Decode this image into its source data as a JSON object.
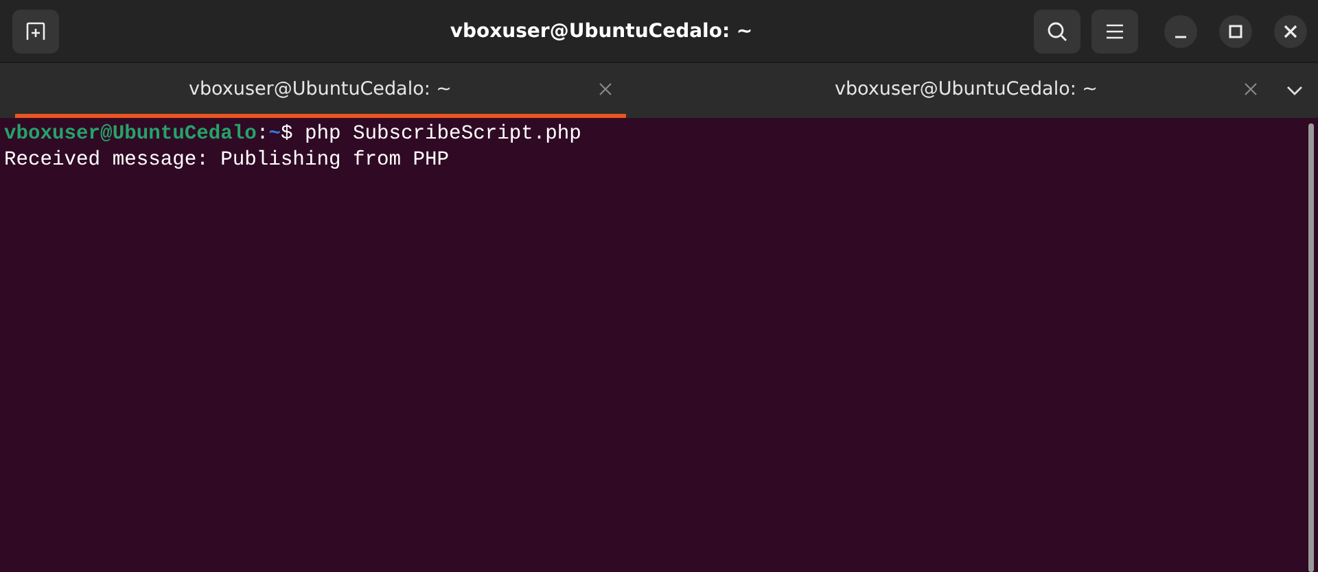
{
  "window": {
    "title": "vboxuser@UbuntuCedalo: ~"
  },
  "tabs": [
    {
      "label": "vboxuser@UbuntuCedalo: ~",
      "selected": true
    },
    {
      "label": "vboxuser@UbuntuCedalo: ~",
      "selected": false
    }
  ],
  "terminal": {
    "lines": [
      {
        "segments": [
          {
            "kind": "user_host",
            "text": "vboxuser@UbuntuCedalo"
          },
          {
            "kind": "plain",
            "text": ":"
          },
          {
            "kind": "path",
            "text": "~"
          },
          {
            "kind": "plain",
            "text": "$ php SubscribeScript.php"
          }
        ]
      },
      {
        "segments": [
          {
            "kind": "plain",
            "text": "Received message: Publishing from PHP"
          }
        ]
      }
    ]
  }
}
